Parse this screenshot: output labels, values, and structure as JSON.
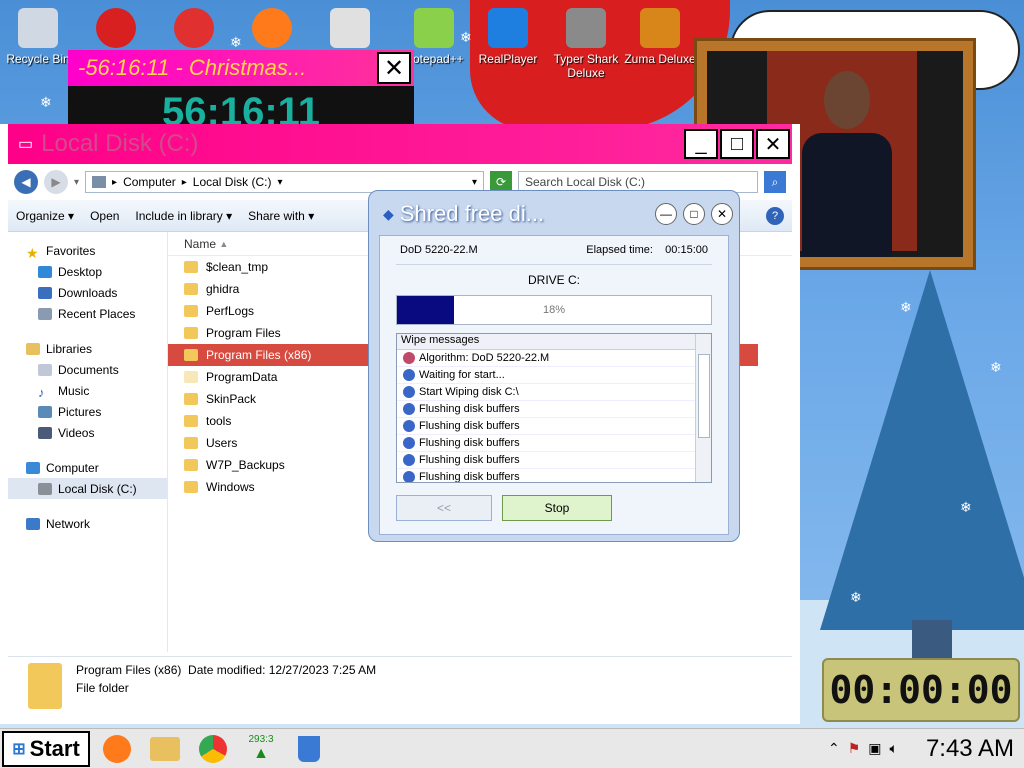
{
  "desktop": {
    "icons": [
      {
        "label": "Recycle Bin",
        "icon": "recycle-bin-icon",
        "color": "#cfd8e3"
      },
      {
        "label": "",
        "icon": "game-icon",
        "color": "#d82020"
      },
      {
        "label": "",
        "icon": "puffle-icon",
        "color": "#e03030"
      },
      {
        "label": "",
        "icon": "firefox-icon",
        "color": "#ff7a1a"
      },
      {
        "label": "",
        "icon": "shrine-icon",
        "color": "#e0e0e0"
      },
      {
        "label": "Notepad++",
        "icon": "notepadpp-icon",
        "color": "#8ad04a"
      },
      {
        "label": "RealPlayer",
        "icon": "realplayer-icon",
        "color": "#1e7fe0"
      },
      {
        "label": "Typer Shark Deluxe",
        "icon": "typer-shark-icon",
        "color": "#8a8a8a"
      },
      {
        "label": "Zuma Deluxe",
        "icon": "zuma-icon",
        "color": "#d8861a"
      }
    ]
  },
  "countdown": {
    "title": "-56:16:11 - Christmas...",
    "big": "56:16:11"
  },
  "explorer": {
    "title": "Local Disk (C:)",
    "breadcrumbs": [
      "Computer",
      "Local Disk (C:)"
    ],
    "search_placeholder": "Search Local Disk (C:)",
    "toolbar": [
      "Organize",
      "Open",
      "Include in library",
      "Share with"
    ],
    "nav": {
      "favorites": [
        "Favorites",
        "Desktop",
        "Downloads",
        "Recent Places"
      ],
      "libraries": [
        "Libraries",
        "Documents",
        "Music",
        "Pictures",
        "Videos"
      ],
      "computer": [
        "Computer",
        "Local Disk (C:)"
      ],
      "network": [
        "Network"
      ]
    },
    "column_name": "Name",
    "files": [
      "$clean_tmp",
      "ghidra",
      "PerfLogs",
      "Program Files",
      "Program Files (x86)",
      "ProgramData",
      "SkinPack",
      "tools",
      "Users",
      "W7P_Backups",
      "Windows"
    ],
    "selected_index": 4,
    "details": {
      "name": "Program Files (x86)",
      "modified_label": "Date modified:",
      "modified": "12/27/2023 7:25 AM",
      "type": "File folder"
    }
  },
  "shred": {
    "title": "Shred free di...",
    "algorithm": "DoD 5220-22.M",
    "elapsed_label": "Elapsed time:",
    "elapsed": "00:15:00",
    "drive": "DRIVE C:",
    "progress": 18,
    "progress_label": "18%",
    "messages_header": "Wipe messages",
    "messages": [
      "Algorithm: DoD 5220-22.M",
      "Waiting for start...",
      "Start Wiping disk C:\\",
      "Flushing disk buffers",
      "Flushing disk buffers",
      "Flushing disk buffers",
      "Flushing disk buffers",
      "Flushing disk buffers"
    ],
    "back_label": "<<",
    "stop_label": "Stop"
  },
  "clock_gadget": "00:00:00",
  "taskbar": {
    "start_label": "Start",
    "badge": "293:3",
    "time": "7:43 AM"
  }
}
